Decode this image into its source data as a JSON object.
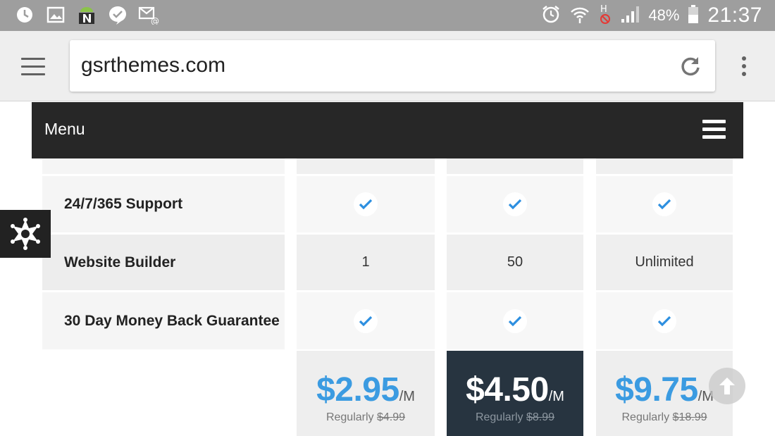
{
  "status_bar": {
    "battery_text": "48%",
    "time": "21:37",
    "left_icons": [
      "clock-notification-icon",
      "image-notification-icon",
      "android-n-icon",
      "check-bubble-icon",
      "email-icon"
    ],
    "right_icons": [
      "alarm-icon",
      "wifi-icon",
      "hplus-no-data-icon",
      "signal-icon",
      "battery-icon"
    ]
  },
  "browser": {
    "url": "gsrthemes.com"
  },
  "site_menu": {
    "label": "Menu"
  },
  "table": {
    "rows": [
      {
        "label": "24/7/365 Support",
        "values": [
          "check",
          "check",
          "check"
        ]
      },
      {
        "label": "Website Builder",
        "values": [
          "1",
          "50",
          "Unlimited"
        ]
      },
      {
        "label": "30 Day Money Back Guarantee",
        "values": [
          "check",
          "check",
          "check"
        ]
      }
    ]
  },
  "plans": [
    {
      "price": "$2.95",
      "per": "/M",
      "regular_label": "Regularly",
      "regular_price": "$4.99",
      "highlighted": false
    },
    {
      "price": "$4.50",
      "per": "/M",
      "regular_label": "Regularly",
      "regular_price": "$8.99",
      "highlighted": true
    },
    {
      "price": "$9.75",
      "per": "/M",
      "regular_label": "Regularly",
      "regular_price": "$18.99",
      "highlighted": false
    }
  ],
  "colors": {
    "accent_blue": "#3b9be1",
    "menu_bar": "#272727",
    "highlight_plan": "#273440",
    "status_bar": "#9e9e9e"
  }
}
